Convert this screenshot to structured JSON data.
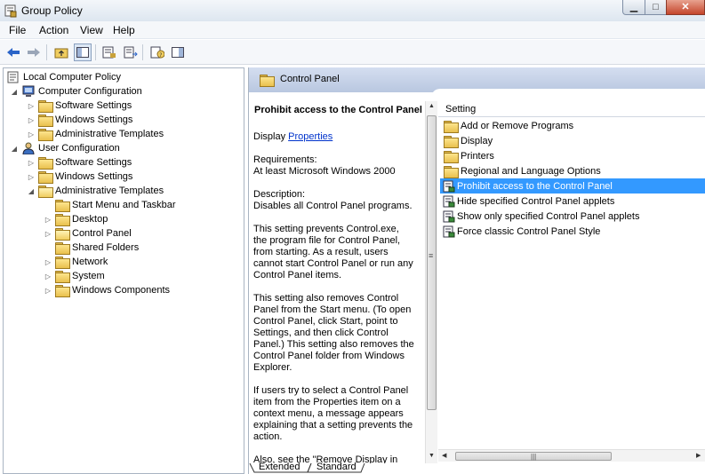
{
  "window": {
    "title": "Group Policy",
    "min_glyph": "▁",
    "max_glyph": "□",
    "close_glyph": "✕"
  },
  "menu": [
    "File",
    "Action",
    "View",
    "Help"
  ],
  "toolbar": {
    "icons": [
      "back-arrow-icon",
      "forward-arrow-icon",
      "up-folder-icon",
      "show-hide-tree-icon",
      "properties-icon",
      "export-list-icon",
      "help-icon",
      "show-hide-action-pane-icon"
    ]
  },
  "tree": {
    "root": "Local Computer Policy",
    "nodes": [
      {
        "label": "Computer Configuration"
      },
      {
        "label": "Software Settings"
      },
      {
        "label": "Windows Settings"
      },
      {
        "label": "Administrative Templates"
      },
      {
        "label": "User Configuration"
      },
      {
        "label": "Software Settings"
      },
      {
        "label": "Windows Settings"
      },
      {
        "label": "Administrative Templates"
      },
      {
        "label": "Start Menu and Taskbar"
      },
      {
        "label": "Desktop"
      },
      {
        "label": "Control Panel"
      },
      {
        "label": "Shared Folders"
      },
      {
        "label": "Network"
      },
      {
        "label": "System"
      },
      {
        "label": "Windows Components"
      }
    ]
  },
  "right": {
    "header": "Control Panel",
    "description": {
      "title": "Prohibit access to the Control Panel",
      "display_prefix": "Display ",
      "display_link": "Properties",
      "lines": [
        "Requirements:",
        "At least Microsoft Windows 2000",
        "Description:",
        "Disables all Control Panel programs.",
        "This setting prevents Control.exe,",
        "the program file for Control Panel,",
        "from starting. As a result, users",
        "cannot start Control Panel or run any",
        "Control Panel items.",
        "This setting also removes Control",
        "Panel from the Start menu. (To open",
        "Control Panel, click Start, point to",
        "Settings, and then click Control",
        "Panel.) This setting also removes the",
        "Control Panel folder from Windows",
        "Explorer.",
        "If users try to select a Control Panel",
        "item from the Properties item on a",
        "context menu, a message appears",
        "explaining that a setting prevents the",
        "action.",
        "Also, see the \"Remove Display in"
      ]
    },
    "list_header": "Setting",
    "items": [
      {
        "label": "Add or Remove Programs",
        "kind": "folder"
      },
      {
        "label": "Display",
        "kind": "folder"
      },
      {
        "label": "Printers",
        "kind": "folder"
      },
      {
        "label": "Regional and Language Options",
        "kind": "folder"
      },
      {
        "label": "Prohibit access to the Control Panel",
        "kind": "policy",
        "selected": true
      },
      {
        "label": "Hide specified Control Panel applets",
        "kind": "policy"
      },
      {
        "label": "Show only specified Control Panel applets",
        "kind": "policy"
      },
      {
        "label": "Force classic Control Panel Style",
        "kind": "policy"
      }
    ],
    "hscroll_grip": "|||",
    "vscroll_grip": "≡",
    "tabs": [
      "Extended",
      "Standard"
    ]
  },
  "colors": {
    "selection": "#3399ff",
    "link": "#0033cc",
    "header_gradient_top": "#d4def0"
  }
}
